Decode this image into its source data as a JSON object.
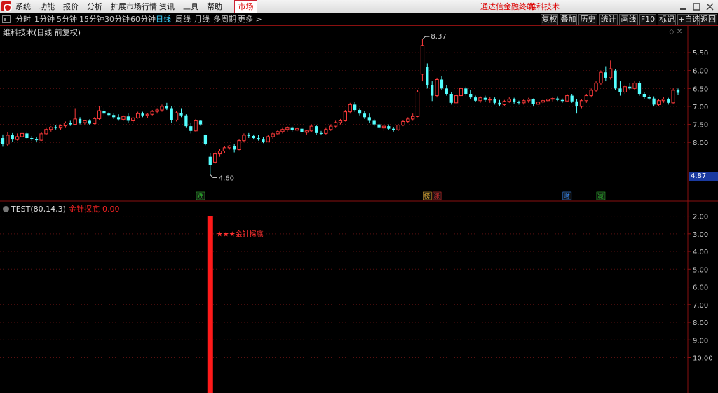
{
  "menubar": {
    "items": [
      "系统",
      "功能",
      "报价",
      "分析",
      "扩展市场行情",
      "资讯",
      "工具",
      "帮助"
    ],
    "market": "市场",
    "brand": "通达信金融终端",
    "stock_name": "维科技术"
  },
  "periods": {
    "items": [
      "分时",
      "1分钟",
      "5分钟",
      "15分钟",
      "30分钟",
      "60分钟",
      "日线",
      "周线",
      "月线",
      "多周期",
      "更多 >"
    ],
    "active": "日线"
  },
  "tools": [
    "复权",
    "叠加",
    "历史",
    "统计",
    "画线",
    "F10",
    "标记",
    "+自选",
    "返回"
  ],
  "price_panel": {
    "title": "维科技术(日线 前复权)",
    "high_label": "8.37",
    "low_label": "4.60",
    "current_price": "4.87",
    "markers": [
      {
        "text": "跌",
        "color": "#2fbf2f"
      },
      {
        "text": "榜",
        "color": "#d2a030"
      },
      {
        "text": "涨",
        "color": "#e03030"
      },
      {
        "text": "财",
        "color": "#3a8fff"
      },
      {
        "text": "减",
        "color": "#2fbf2f"
      }
    ],
    "y_ticks": [
      "8.00",
      "7.50",
      "7.00",
      "6.50",
      "6.00",
      "5.50"
    ]
  },
  "indicator_panel": {
    "name": "TEST(80,14,3)",
    "signal_name": "金针探底",
    "signal_value": "0.00",
    "annotation": "★★★金针探底",
    "y_ticks": [
      "10.00",
      "9.00",
      "8.00",
      "7.00",
      "6.00",
      "5.00",
      "4.00",
      "3.00",
      "2.00"
    ]
  },
  "chart_data": [
    {
      "type": "candlestick",
      "title": "维科技术(日线 前复权)",
      "ylim": [
        4.45,
        8.45
      ],
      "y_ticks": [
        5.5,
        6.0,
        6.5,
        7.0,
        7.5,
        8.0
      ],
      "annotations": [
        {
          "text": "8.37",
          "value": 8.37
        },
        {
          "text": "4.60",
          "value": 4.6
        }
      ],
      "ohlc": [
        [
          5.62,
          5.72,
          5.38,
          5.45
        ],
        [
          5.45,
          5.78,
          5.4,
          5.7
        ],
        [
          5.7,
          5.76,
          5.52,
          5.58
        ],
        [
          5.58,
          5.75,
          5.55,
          5.66
        ],
        [
          5.66,
          5.8,
          5.6,
          5.75
        ],
        [
          5.75,
          5.8,
          5.6,
          5.62
        ],
        [
          5.62,
          5.68,
          5.55,
          5.6
        ],
        [
          5.6,
          5.65,
          5.52,
          5.56
        ],
        [
          5.56,
          5.78,
          5.54,
          5.74
        ],
        [
          5.74,
          5.9,
          5.7,
          5.86
        ],
        [
          5.86,
          5.95,
          5.8,
          5.92
        ],
        [
          5.92,
          5.98,
          5.86,
          5.9
        ],
        [
          5.9,
          6.0,
          5.85,
          5.96
        ],
        [
          5.96,
          6.08,
          5.9,
          6.04
        ],
        [
          6.04,
          6.1,
          5.96,
          6.0
        ],
        [
          6.0,
          6.45,
          5.98,
          6.15
        ],
        [
          6.15,
          6.2,
          6.0,
          6.05
        ],
        [
          6.05,
          6.12,
          6.0,
          6.1
        ],
        [
          6.1,
          6.14,
          5.98,
          6.02
        ],
        [
          6.02,
          6.2,
          6.0,
          6.16
        ],
        [
          6.16,
          6.5,
          6.12,
          6.38
        ],
        [
          6.38,
          6.45,
          6.25,
          6.3
        ],
        [
          6.3,
          6.34,
          6.22,
          6.26
        ],
        [
          6.26,
          6.3,
          6.15,
          6.2
        ],
        [
          6.2,
          6.28,
          6.1,
          6.14
        ],
        [
          6.14,
          6.25,
          6.1,
          6.22
        ],
        [
          6.22,
          6.3,
          6.05,
          6.1
        ],
        [
          6.1,
          6.2,
          6.05,
          6.18
        ],
        [
          6.18,
          6.35,
          6.16,
          6.3
        ],
        [
          6.3,
          6.35,
          6.2,
          6.25
        ],
        [
          6.25,
          6.32,
          6.18,
          6.28
        ],
        [
          6.28,
          6.4,
          6.25,
          6.36
        ],
        [
          6.36,
          6.45,
          6.3,
          6.4
        ],
        [
          6.4,
          6.55,
          6.35,
          6.5
        ],
        [
          6.5,
          6.6,
          6.4,
          6.45
        ],
        [
          6.45,
          6.5,
          6.05,
          6.12
        ],
        [
          6.12,
          6.38,
          6.08,
          6.32
        ],
        [
          6.32,
          6.45,
          6.2,
          6.25
        ],
        [
          6.25,
          6.28,
          5.9,
          5.95
        ],
        [
          5.95,
          6.05,
          5.75,
          5.82
        ],
        [
          5.82,
          6.15,
          5.8,
          6.1
        ],
        [
          6.1,
          6.12,
          5.96,
          6.0
        ],
        [
          5.7,
          5.72,
          5.42,
          5.45
        ],
        [
          5.1,
          5.2,
          4.6,
          4.87
        ],
        [
          4.95,
          5.25,
          4.9,
          5.18
        ],
        [
          5.18,
          5.32,
          5.1,
          5.26
        ],
        [
          5.26,
          5.4,
          5.2,
          5.35
        ],
        [
          5.35,
          5.42,
          5.3,
          5.4
        ],
        [
          5.4,
          5.45,
          5.22,
          5.3
        ],
        [
          5.3,
          5.6,
          5.28,
          5.55
        ],
        [
          5.55,
          5.75,
          5.5,
          5.7
        ],
        [
          5.7,
          5.76,
          5.62,
          5.68
        ],
        [
          5.68,
          5.72,
          5.58,
          5.62
        ],
        [
          5.62,
          5.7,
          5.55,
          5.58
        ],
        [
          5.58,
          5.65,
          5.48,
          5.52
        ],
        [
          5.52,
          5.7,
          5.5,
          5.66
        ],
        [
          5.66,
          5.78,
          5.6,
          5.74
        ],
        [
          5.74,
          5.85,
          5.7,
          5.8
        ],
        [
          5.8,
          5.9,
          5.75,
          5.86
        ],
        [
          5.86,
          5.95,
          5.8,
          5.9
        ],
        [
          5.9,
          5.94,
          5.8,
          5.84
        ],
        [
          5.84,
          5.92,
          5.8,
          5.88
        ],
        [
          5.88,
          5.9,
          5.74,
          5.78
        ],
        [
          5.78,
          5.85,
          5.72,
          5.82
        ],
        [
          5.82,
          6.0,
          5.78,
          5.95
        ],
        [
          5.95,
          5.98,
          5.7,
          5.76
        ],
        [
          5.76,
          5.82,
          5.7,
          5.75
        ],
        [
          5.75,
          5.9,
          5.72,
          5.86
        ],
        [
          5.86,
          6.0,
          5.82,
          5.95
        ],
        [
          5.95,
          6.1,
          5.9,
          6.05
        ],
        [
          6.05,
          6.15,
          6.0,
          6.1
        ],
        [
          6.1,
          6.4,
          6.08,
          6.35
        ],
        [
          6.35,
          6.6,
          6.3,
          6.55
        ],
        [
          6.55,
          6.62,
          6.35,
          6.4
        ],
        [
          6.4,
          6.45,
          6.25,
          6.3
        ],
        [
          6.3,
          6.38,
          6.15,
          6.2
        ],
        [
          6.2,
          6.3,
          6.05,
          6.1
        ],
        [
          6.1,
          6.15,
          5.95,
          6.0
        ],
        [
          6.0,
          6.05,
          5.85,
          5.9
        ],
        [
          5.9,
          6.0,
          5.82,
          5.95
        ],
        [
          5.95,
          6.0,
          5.85,
          5.88
        ],
        [
          5.88,
          5.92,
          5.8,
          5.85
        ],
        [
          5.85,
          6.0,
          5.82,
          5.98
        ],
        [
          5.98,
          6.12,
          5.95,
          6.08
        ],
        [
          6.08,
          6.2,
          6.05,
          6.15
        ],
        [
          6.15,
          6.3,
          6.1,
          6.22
        ],
        [
          6.22,
          6.95,
          6.2,
          6.9
        ],
        [
          7.4,
          8.37,
          7.2,
          8.2
        ],
        [
          7.6,
          7.7,
          7.0,
          7.1
        ],
        [
          7.1,
          7.2,
          6.65,
          6.8
        ],
        [
          6.8,
          7.3,
          6.75,
          7.25
        ],
        [
          7.25,
          7.35,
          6.95,
          7.0
        ],
        [
          7.0,
          7.1,
          6.8,
          6.85
        ],
        [
          6.85,
          6.9,
          6.55,
          6.6
        ],
        [
          6.6,
          6.85,
          6.58,
          6.8
        ],
        [
          6.8,
          7.05,
          6.75,
          7.0
        ],
        [
          7.0,
          7.05,
          6.8,
          6.85
        ],
        [
          6.85,
          6.95,
          6.7,
          6.75
        ],
        [
          6.75,
          6.8,
          6.62,
          6.66
        ],
        [
          6.66,
          6.78,
          6.6,
          6.74
        ],
        [
          6.74,
          6.8,
          6.62,
          6.68
        ],
        [
          6.68,
          6.76,
          6.6,
          6.7
        ],
        [
          6.7,
          6.75,
          6.55,
          6.6
        ],
        [
          6.6,
          6.68,
          6.5,
          6.55
        ],
        [
          6.55,
          6.68,
          6.52,
          6.64
        ],
        [
          6.64,
          6.75,
          6.6,
          6.7
        ],
        [
          6.7,
          6.74,
          6.58,
          6.62
        ],
        [
          6.62,
          6.66,
          6.55,
          6.6
        ],
        [
          6.6,
          6.7,
          6.55,
          6.66
        ],
        [
          6.66,
          6.74,
          6.6,
          6.7
        ],
        [
          6.7,
          6.72,
          6.52,
          6.56
        ],
        [
          6.56,
          6.66,
          6.52,
          6.62
        ],
        [
          6.62,
          6.7,
          6.58,
          6.66
        ],
        [
          6.66,
          6.72,
          6.62,
          6.7
        ],
        [
          6.7,
          6.76,
          6.64,
          6.72
        ],
        [
          6.72,
          6.78,
          6.65,
          6.68
        ],
        [
          6.68,
          6.72,
          6.6,
          6.65
        ],
        [
          6.65,
          6.85,
          6.62,
          6.8
        ],
        [
          6.8,
          6.85,
          6.6,
          6.64
        ],
        [
          6.64,
          6.7,
          6.3,
          6.5
        ],
        [
          6.5,
          6.7,
          6.45,
          6.66
        ],
        [
          6.66,
          6.85,
          6.6,
          6.8
        ],
        [
          6.8,
          7.0,
          6.75,
          6.95
        ],
        [
          6.95,
          7.2,
          6.9,
          7.15
        ],
        [
          7.15,
          7.5,
          7.1,
          7.45
        ],
        [
          7.45,
          7.62,
          7.2,
          7.3
        ],
        [
          7.3,
          7.78,
          7.25,
          7.55
        ],
        [
          7.5,
          7.55,
          6.95,
          7.0
        ],
        [
          7.0,
          7.2,
          6.8,
          6.9
        ],
        [
          6.9,
          7.1,
          6.85,
          7.05
        ],
        [
          7.05,
          7.15,
          6.95,
          7.0
        ],
        [
          7.0,
          7.2,
          6.95,
          7.15
        ],
        [
          7.15,
          7.2,
          6.8,
          6.85
        ],
        [
          6.85,
          6.9,
          6.7,
          6.76
        ],
        [
          6.76,
          6.82,
          6.68,
          6.72
        ],
        [
          6.72,
          6.78,
          6.5,
          6.55
        ],
        [
          6.55,
          6.7,
          6.5,
          6.66
        ],
        [
          6.66,
          6.76,
          6.6,
          6.7
        ],
        [
          6.7,
          6.74,
          6.55,
          6.6
        ],
        [
          6.6,
          7.0,
          6.58,
          6.95
        ],
        [
          6.95,
          7.0,
          6.82,
          6.88
        ]
      ]
    },
    {
      "type": "bar",
      "title": "TEST(80,14,3)",
      "series": [
        {
          "name": "金针探底",
          "signal_index": 43,
          "value": 10
        }
      ],
      "ylim": [
        0,
        10.3
      ],
      "y_ticks": [
        2,
        3,
        4,
        5,
        6,
        7,
        8,
        9,
        10
      ]
    }
  ]
}
